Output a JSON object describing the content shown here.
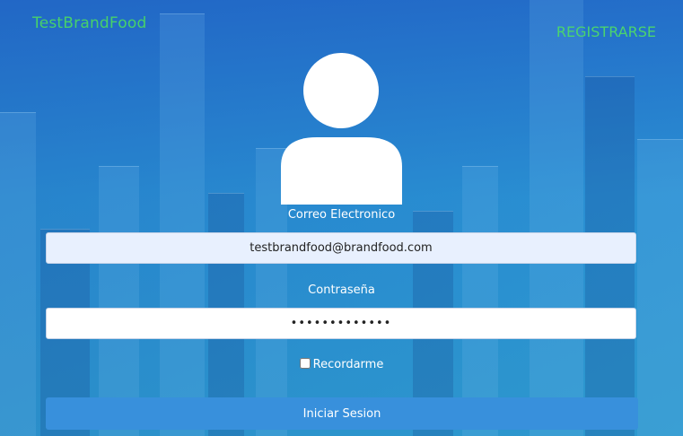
{
  "header": {
    "brand": "TestBrandFood",
    "register_link": "REGISTRARSE"
  },
  "login": {
    "avatar_icon": "user-icon",
    "email_label": "Correo Electronico",
    "email_value": "testbrandfood@brandfood.com",
    "password_label": "Contraseña",
    "password_value": "•••••••••••••",
    "remember_label": "Recordarme",
    "submit_label": "Iniciar Sesion"
  },
  "colors": {
    "brand_green": "#47d16a",
    "button_blue": "#3890dc",
    "email_field_bg": "#e8f0fe"
  }
}
